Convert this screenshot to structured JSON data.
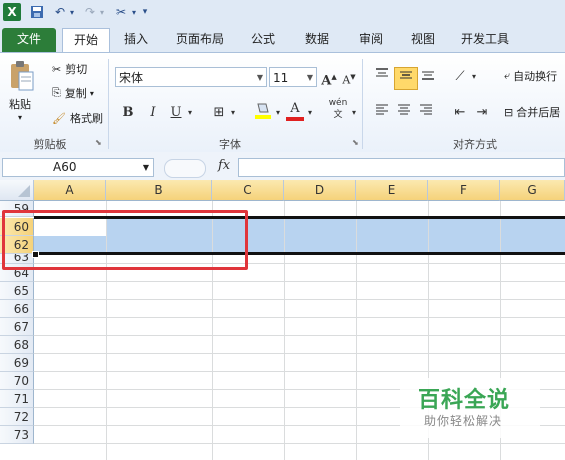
{
  "qat": {
    "excel_icon": "X",
    "more": "▾"
  },
  "tabs": [
    "文件",
    "开始",
    "插入",
    "页面布局",
    "公式",
    "数据",
    "审阅",
    "视图",
    "开发工具"
  ],
  "clipboard": {
    "paste": "粘贴",
    "cut": "剪切",
    "copy": "复制",
    "format_painter": "格式刷",
    "label": "剪贴板"
  },
  "font": {
    "name": "宋体",
    "size": "11",
    "bold": "B",
    "italic": "I",
    "underline": "U",
    "grow": "A",
    "shrink": "A",
    "label": "字体",
    "font_color_icon": "A",
    "phonetic": "wén"
  },
  "align": {
    "wrap": "自动换行",
    "merge": "合并后居",
    "label": "对齐方式"
  },
  "formula_bar": {
    "name_box": "A60",
    "fx": "fx"
  },
  "columns": [
    "A",
    "B",
    "C",
    "D",
    "E",
    "F",
    "G"
  ],
  "rows": [
    "59",
    "60",
    "62",
    "63",
    "64",
    "65",
    "66",
    "67",
    "68",
    "69",
    "70",
    "71",
    "72",
    "73"
  ],
  "watermark": {
    "title": "百科全说",
    "subtitle": "助你轻松解决"
  },
  "colors": {
    "file_tab": "#2c7d39",
    "selection": "#b8d3f0",
    "highlight_box": "#e0353b"
  }
}
